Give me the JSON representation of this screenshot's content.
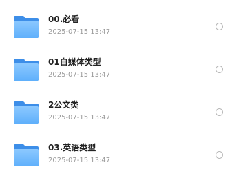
{
  "files": [
    {
      "name": "00.必看",
      "date": "2025-07-15 13:47",
      "icon": "folder-icon"
    },
    {
      "name": "01自媒体类型",
      "date": "2025-07-15 13:47",
      "icon": "folder-icon"
    },
    {
      "name": "2公文类",
      "date": "2025-07-15 13:47",
      "icon": "folder-icon"
    },
    {
      "name": "03.英语类型",
      "date": "2025-07-15 13:47",
      "icon": "folder-icon"
    }
  ],
  "colors": {
    "folder_back": "#3d8ee8",
    "folder_front": "#6ab8fd",
    "title_text": "#222222",
    "date_text": "#9a9a9a",
    "radio_border": "#b8b8b8"
  }
}
